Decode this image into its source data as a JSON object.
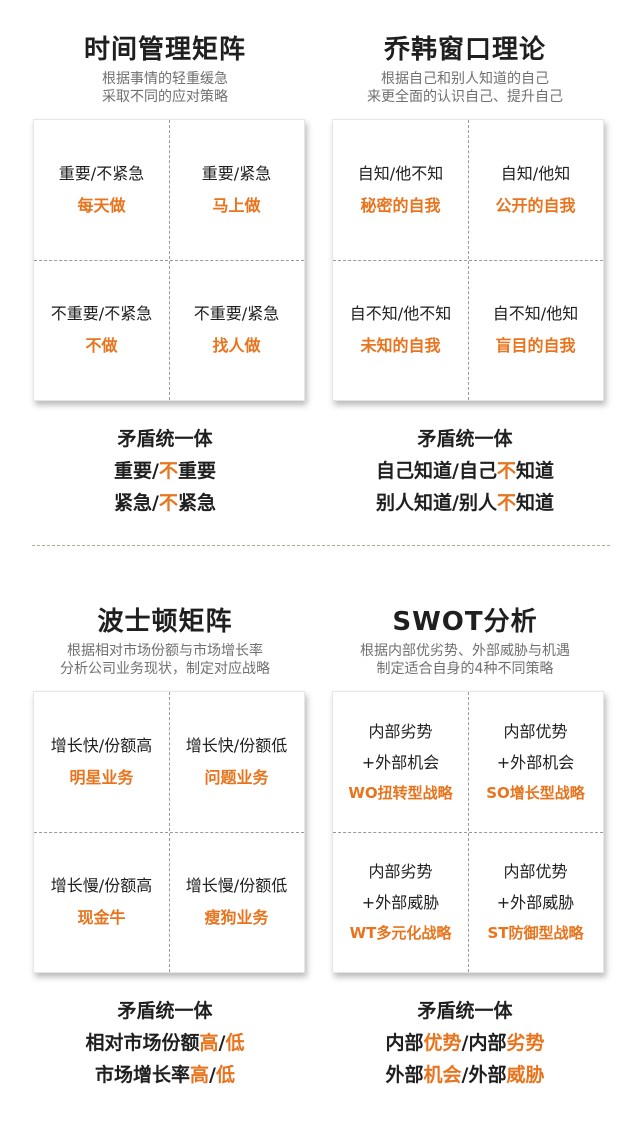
{
  "accent_color": "#e8741e",
  "panels": [
    {
      "title": "时间管理矩阵",
      "subtitle_lines": [
        "根据事情的轻重缓急",
        "采取不同的应对策略"
      ],
      "cells": [
        {
          "label": "重要/不紧急",
          "accent": "每天做"
        },
        {
          "label": "重要/紧急",
          "accent": "马上做"
        },
        {
          "label": "不重要/不紧急",
          "accent": "不做"
        },
        {
          "label": "不重要/紧急",
          "accent": "找人做"
        }
      ],
      "summary": {
        "heading": "矛盾统一体",
        "line1": {
          "a": "重要/",
          "b": "不",
          "c": "重要"
        },
        "line2": {
          "a": "紧急/",
          "b": "不",
          "c": "紧急"
        }
      }
    },
    {
      "title": "乔韩窗口理论",
      "subtitle_lines": [
        "根据自己和别人知道的自己",
        "来更全面的认识自己、提升自己"
      ],
      "cells": [
        {
          "label": "自知/他不知",
          "accent": "秘密的自我"
        },
        {
          "label": "自知/他知",
          "accent": "公开的自我"
        },
        {
          "label": "自不知/他不知",
          "accent": "未知的自我"
        },
        {
          "label": "自不知/他知",
          "accent": "盲目的自我"
        }
      ],
      "summary": {
        "heading": "矛盾统一体",
        "line1": {
          "a": "自己知道/自己",
          "b": "不",
          "c": "知道"
        },
        "line2": {
          "a": "别人知道/别人",
          "b": "不",
          "c": "知道"
        }
      }
    },
    {
      "title": "波士顿矩阵",
      "subtitle_lines": [
        "根据相对市场份额与市场增长率",
        "分析公司业务现状，制定对应战略"
      ],
      "cells": [
        {
          "label": "增长快/份额高",
          "accent": "明星业务"
        },
        {
          "label": "增长快/份额低",
          "accent": "问题业务"
        },
        {
          "label": "增长慢/份额高",
          "accent": "现金牛"
        },
        {
          "label": "增长慢/份额低",
          "accent": "瘦狗业务"
        }
      ],
      "summary": {
        "heading": "矛盾统一体",
        "line1": {
          "a": "相对市场份额",
          "b": "高",
          "c": "/",
          "d": "低"
        },
        "line2": {
          "a": "市场增长率",
          "b": "高",
          "c": "/",
          "d": "低"
        }
      }
    },
    {
      "title": "SWOT分析",
      "subtitle_lines": [
        "根据内部优劣势、外部威胁与机遇",
        "制定适合自身的4种不同策略"
      ],
      "cells": [
        {
          "label1": "内部劣势",
          "label2": "+外部机会",
          "accent": "WO扭转型战略"
        },
        {
          "label1": "内部优势",
          "label2": "+外部机会",
          "accent": "SO增长型战略"
        },
        {
          "label1": "内部劣势",
          "label2": "+外部威胁",
          "accent": "WT多元化战略"
        },
        {
          "label1": "内部优势",
          "label2": "+外部威胁",
          "accent": "ST防御型战略"
        }
      ],
      "summary": {
        "heading": "矛盾统一体",
        "line1": {
          "a": "内部",
          "b": "优势",
          "c": "/内部",
          "d": "劣势"
        },
        "line2": {
          "a": "外部",
          "b": "机会",
          "c": "/外部",
          "d": "威胁"
        }
      }
    }
  ]
}
